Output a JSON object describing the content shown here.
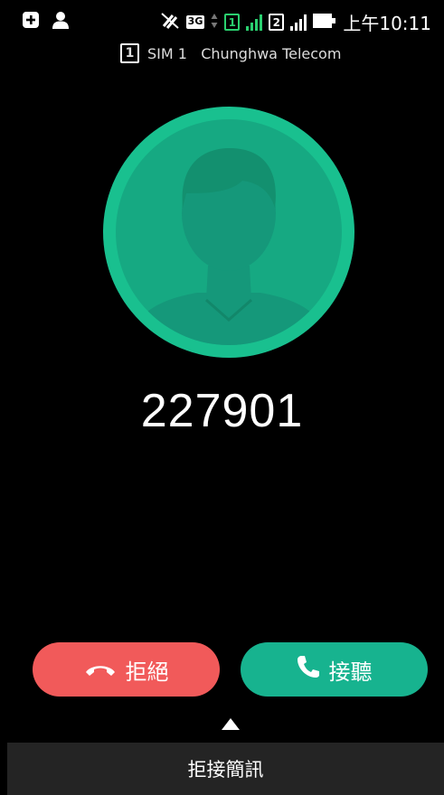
{
  "status_bar": {
    "network_type": "3G",
    "sim1_label": "1",
    "sim2_label": "2",
    "time": "上午10:11"
  },
  "carrier": {
    "sim_label": "1",
    "text": "SIM 1   Chunghwa Telecom"
  },
  "caller": {
    "number": "227901"
  },
  "actions": {
    "decline_label": "拒絕",
    "answer_label": "接聽",
    "reject_sms_label": "拒接簡訊"
  },
  "colors": {
    "background": "#000000",
    "avatar_ring": "#19c08f",
    "avatar_fill": "#16a982",
    "decline": "#f15a5a",
    "answer": "#17b38f",
    "sms_bar": "#242424",
    "signal_green": "#2ad06f"
  },
  "icons": {
    "status_left": [
      "add-icon",
      "person-icon"
    ],
    "status_right": [
      "vibrate-off-icon",
      "data-arrows-icon",
      "signal-icon",
      "battery-icon"
    ],
    "decline": "phone-hangup-icon",
    "answer": "phone-icon",
    "swipe": "arrow-up-icon"
  }
}
